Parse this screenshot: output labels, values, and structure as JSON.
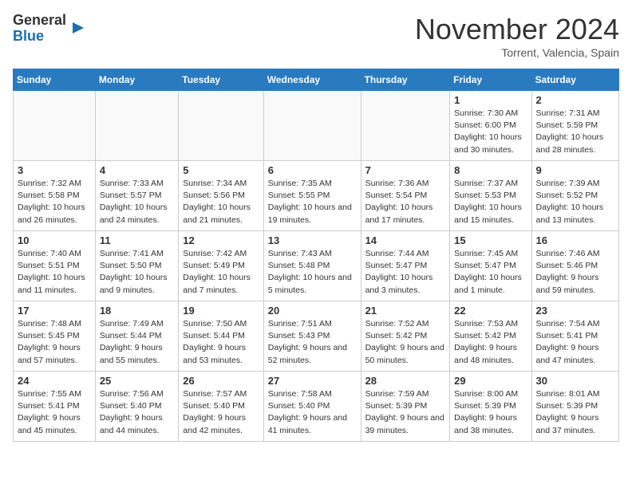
{
  "header": {
    "logo_line1": "General",
    "logo_line2": "Blue",
    "month": "November 2024",
    "location": "Torrent, Valencia, Spain"
  },
  "weekdays": [
    "Sunday",
    "Monday",
    "Tuesday",
    "Wednesday",
    "Thursday",
    "Friday",
    "Saturday"
  ],
  "weeks": [
    [
      {
        "day": "",
        "info": ""
      },
      {
        "day": "",
        "info": ""
      },
      {
        "day": "",
        "info": ""
      },
      {
        "day": "",
        "info": ""
      },
      {
        "day": "",
        "info": ""
      },
      {
        "day": "1",
        "info": "Sunrise: 7:30 AM\nSunset: 6:00 PM\nDaylight: 10 hours and 30 minutes."
      },
      {
        "day": "2",
        "info": "Sunrise: 7:31 AM\nSunset: 5:59 PM\nDaylight: 10 hours and 28 minutes."
      }
    ],
    [
      {
        "day": "3",
        "info": "Sunrise: 7:32 AM\nSunset: 5:58 PM\nDaylight: 10 hours and 26 minutes."
      },
      {
        "day": "4",
        "info": "Sunrise: 7:33 AM\nSunset: 5:57 PM\nDaylight: 10 hours and 24 minutes."
      },
      {
        "day": "5",
        "info": "Sunrise: 7:34 AM\nSunset: 5:56 PM\nDaylight: 10 hours and 21 minutes."
      },
      {
        "day": "6",
        "info": "Sunrise: 7:35 AM\nSunset: 5:55 PM\nDaylight: 10 hours and 19 minutes."
      },
      {
        "day": "7",
        "info": "Sunrise: 7:36 AM\nSunset: 5:54 PM\nDaylight: 10 hours and 17 minutes."
      },
      {
        "day": "8",
        "info": "Sunrise: 7:37 AM\nSunset: 5:53 PM\nDaylight: 10 hours and 15 minutes."
      },
      {
        "day": "9",
        "info": "Sunrise: 7:39 AM\nSunset: 5:52 PM\nDaylight: 10 hours and 13 minutes."
      }
    ],
    [
      {
        "day": "10",
        "info": "Sunrise: 7:40 AM\nSunset: 5:51 PM\nDaylight: 10 hours and 11 minutes."
      },
      {
        "day": "11",
        "info": "Sunrise: 7:41 AM\nSunset: 5:50 PM\nDaylight: 10 hours and 9 minutes."
      },
      {
        "day": "12",
        "info": "Sunrise: 7:42 AM\nSunset: 5:49 PM\nDaylight: 10 hours and 7 minutes."
      },
      {
        "day": "13",
        "info": "Sunrise: 7:43 AM\nSunset: 5:48 PM\nDaylight: 10 hours and 5 minutes."
      },
      {
        "day": "14",
        "info": "Sunrise: 7:44 AM\nSunset: 5:47 PM\nDaylight: 10 hours and 3 minutes."
      },
      {
        "day": "15",
        "info": "Sunrise: 7:45 AM\nSunset: 5:47 PM\nDaylight: 10 hours and 1 minute."
      },
      {
        "day": "16",
        "info": "Sunrise: 7:46 AM\nSunset: 5:46 PM\nDaylight: 9 hours and 59 minutes."
      }
    ],
    [
      {
        "day": "17",
        "info": "Sunrise: 7:48 AM\nSunset: 5:45 PM\nDaylight: 9 hours and 57 minutes."
      },
      {
        "day": "18",
        "info": "Sunrise: 7:49 AM\nSunset: 5:44 PM\nDaylight: 9 hours and 55 minutes."
      },
      {
        "day": "19",
        "info": "Sunrise: 7:50 AM\nSunset: 5:44 PM\nDaylight: 9 hours and 53 minutes."
      },
      {
        "day": "20",
        "info": "Sunrise: 7:51 AM\nSunset: 5:43 PM\nDaylight: 9 hours and 52 minutes."
      },
      {
        "day": "21",
        "info": "Sunrise: 7:52 AM\nSunset: 5:42 PM\nDaylight: 9 hours and 50 minutes."
      },
      {
        "day": "22",
        "info": "Sunrise: 7:53 AM\nSunset: 5:42 PM\nDaylight: 9 hours and 48 minutes."
      },
      {
        "day": "23",
        "info": "Sunrise: 7:54 AM\nSunset: 5:41 PM\nDaylight: 9 hours and 47 minutes."
      }
    ],
    [
      {
        "day": "24",
        "info": "Sunrise: 7:55 AM\nSunset: 5:41 PM\nDaylight: 9 hours and 45 minutes."
      },
      {
        "day": "25",
        "info": "Sunrise: 7:56 AM\nSunset: 5:40 PM\nDaylight: 9 hours and 44 minutes."
      },
      {
        "day": "26",
        "info": "Sunrise: 7:57 AM\nSunset: 5:40 PM\nDaylight: 9 hours and 42 minutes."
      },
      {
        "day": "27",
        "info": "Sunrise: 7:58 AM\nSunset: 5:40 PM\nDaylight: 9 hours and 41 minutes."
      },
      {
        "day": "28",
        "info": "Sunrise: 7:59 AM\nSunset: 5:39 PM\nDaylight: 9 hours and 39 minutes."
      },
      {
        "day": "29",
        "info": "Sunrise: 8:00 AM\nSunset: 5:39 PM\nDaylight: 9 hours and 38 minutes."
      },
      {
        "day": "30",
        "info": "Sunrise: 8:01 AM\nSunset: 5:39 PM\nDaylight: 9 hours and 37 minutes."
      }
    ]
  ]
}
